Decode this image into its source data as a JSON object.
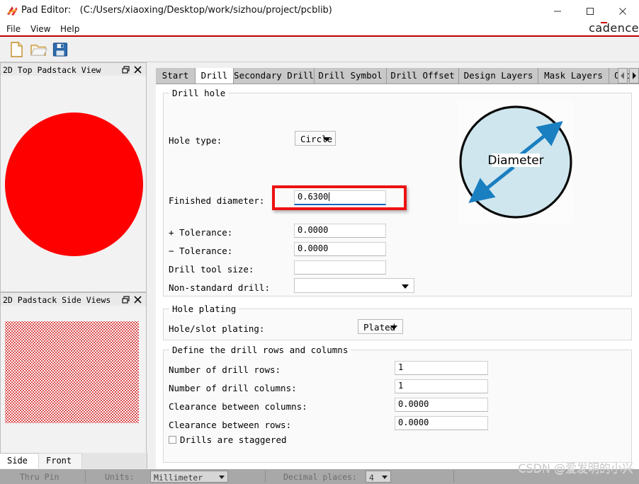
{
  "window": {
    "app_name": "Pad Editor:",
    "file_path": "(C:/Users/xiaoxing/Desktop/work/sizhou/project/pcblib)",
    "brand": "cadence",
    "minimize": "–",
    "maximize": "□",
    "close": "✕"
  },
  "menu": {
    "items": [
      {
        "label": "File"
      },
      {
        "label": "View"
      },
      {
        "label": "Help"
      }
    ]
  },
  "toolbar": {
    "buttons": [
      {
        "name": "new-file-icon",
        "tooltip": "New"
      },
      {
        "name": "open-folder-icon",
        "tooltip": "Open"
      },
      {
        "name": "save-icon",
        "tooltip": "Save"
      }
    ]
  },
  "left_panels": {
    "top_view": {
      "title": "2D Top Padstack View",
      "restore": "❐",
      "close": "✕",
      "pad_color": "#ff0000"
    },
    "side_view": {
      "title": "2D Padstack Side Views",
      "restore": "❐",
      "close": "✕",
      "hatch_color": "#d01010"
    },
    "view_tabs": [
      {
        "label": "Side",
        "active": true
      },
      {
        "label": "Front",
        "active": false
      }
    ]
  },
  "tabs": [
    {
      "label": "Start",
      "active": false
    },
    {
      "label": "Drill",
      "active": true
    },
    {
      "label": "Secondary Drill",
      "active": false
    },
    {
      "label": "Drill Symbol",
      "active": false
    },
    {
      "label": "Drill Offset",
      "active": false
    },
    {
      "label": "Design Layers",
      "active": false
    },
    {
      "label": "Mask Layers",
      "active": false
    },
    {
      "label": "Options",
      "active": false
    }
  ],
  "tab_scroll": {
    "left": "◀",
    "right": "▶"
  },
  "drill_hole": {
    "legend": "Drill hole",
    "hole_type_label": "Hole type:",
    "hole_type_value": "Circle",
    "finished_diameter_label": "Finished diameter:",
    "finished_diameter_value": "0.6300",
    "plus_tolerance_label": "+ Tolerance:",
    "plus_tolerance_value": "0.0000",
    "minus_tolerance_label": "− Tolerance:",
    "minus_tolerance_value": "0.0000",
    "drill_tool_size_label": "Drill tool size:",
    "drill_tool_size_value": "",
    "non_standard_drill_label": "Non-standard drill:",
    "non_standard_drill_value": "",
    "illustration_label": "Diameter",
    "highlight_color": "#ee1111",
    "focus_underline_color": "#1565c0"
  },
  "hole_plating": {
    "legend": "Hole plating",
    "label": "Hole/slot plating:",
    "value": "Plated"
  },
  "drill_rows_columns": {
    "legend": "Define the drill rows and columns",
    "rows": [
      {
        "label": "Number of drill rows:",
        "value": "1"
      },
      {
        "label": "Number of drill columns:",
        "value": "1"
      },
      {
        "label": "Clearance between columns:",
        "value": "0.0000"
      },
      {
        "label": "Clearance between rows:",
        "value": "0.0000"
      }
    ],
    "staggered_label": "Drills are staggered",
    "staggered_checked": false
  },
  "status_bar": {
    "pin_type": "Thru Pin",
    "units_label": "Units:",
    "units_value": "Millimeter",
    "decimal_label": "Decimal places:",
    "decimal_value": "4"
  },
  "watermark": "CSDN @爱发明的小兴"
}
